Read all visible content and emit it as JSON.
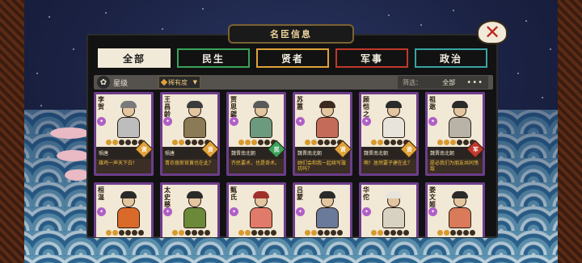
{
  "panel": {
    "title": "名臣信息",
    "close_icon": "close-x-icon"
  },
  "tabs": [
    {
      "label": "全部",
      "color": "#f1ead8",
      "active": true
    },
    {
      "label": "民生",
      "color": "#3aa35a",
      "active": false
    },
    {
      "label": "贤者",
      "color": "#e0a23a",
      "active": false
    },
    {
      "label": "军事",
      "color": "#c0392b",
      "active": false
    },
    {
      "label": "政治",
      "color": "#3aa3a3",
      "active": false
    }
  ],
  "toolbar": {
    "sort_icon": "sort-icon",
    "sort_label": "星级",
    "rarity_label": "稀有度",
    "filter_label": "筛选：",
    "filter_value": "全部",
    "more_label": "•••"
  },
  "cards": [
    {
      "name": "李贺",
      "info": "殒唐",
      "badge": "贤",
      "badge_color": "#e0a23a",
      "quote": "雄鸡一声天下白！",
      "stars": 2,
      "hair": "#7a7a7a",
      "body": "#bdbdbd"
    },
    {
      "name": "王昌龄",
      "info": "殒唐",
      "badge": "贤",
      "badge_color": "#e0a23a",
      "quote": "青衣夜郎官黄也在此？",
      "stars": 2,
      "hair": "#3b3b3b",
      "body": "#8a7a55"
    },
    {
      "name": "贾思勰",
      "info": "魏晋南北朝",
      "badge": "民",
      "badge_color": "#3aa35a",
      "quote": "齐民要术，也是奇术。",
      "stars": 3,
      "hair": "#5a5a5a",
      "body": "#6c9a7e"
    },
    {
      "name": "苏蕙",
      "info": "魏晋南北朝",
      "badge": "贤",
      "badge_color": "#e0a23a",
      "quote": "她们会和我一起续写璇玑吗？",
      "stars": 2,
      "hair": "#3b2a20",
      "body": "#c46b5a"
    },
    {
      "name": "顾恺之",
      "info": "魏晋南北朝",
      "badge": "贤",
      "badge_color": "#e0a23a",
      "quote": "啊！居然要子建在此？",
      "stars": 2,
      "hair": "#2a2a2a",
      "body": "#e8e4dc"
    },
    {
      "name": "祖逖",
      "info": "魏晋南北朝",
      "badge": "军",
      "badge_color": "#c0392b",
      "quote": "愿必我们为朋友共同荡敌",
      "stars": 3,
      "hair": "#2a2a2a",
      "body": "#b8b3a6"
    },
    {
      "name": "桓温",
      "info": "",
      "badge": "",
      "badge_color": "#c0392b",
      "quote": "",
      "stars": 2,
      "hair": "#2a2a2a",
      "body": "#d96a2a"
    },
    {
      "name": "太史慈",
      "info": "",
      "badge": "",
      "badge_color": "#c0392b",
      "quote": "",
      "stars": 2,
      "hair": "#2a2a2a",
      "body": "#6a8a3a"
    },
    {
      "name": "甄氏",
      "info": "",
      "badge": "",
      "badge_color": "#3aa35a",
      "quote": "",
      "stars": 2,
      "hair": "#a0302a",
      "body": "#e07a6a"
    },
    {
      "name": "吕蒙",
      "info": "",
      "badge": "",
      "badge_color": "#c0392b",
      "quote": "",
      "stars": 2,
      "hair": "#2a2a2a",
      "body": "#6a7a9a"
    },
    {
      "name": "华佗",
      "info": "",
      "badge": "",
      "badge_color": "#3aa35a",
      "quote": "",
      "stars": 2,
      "hair": "#e8e4dc",
      "body": "#d8d2c2"
    },
    {
      "name": "娄文姬",
      "info": "",
      "badge": "",
      "badge_color": "#e0a23a",
      "quote": "",
      "stars": 2,
      "hair": "#2a2a2a",
      "body": "#d97a5a"
    }
  ]
}
